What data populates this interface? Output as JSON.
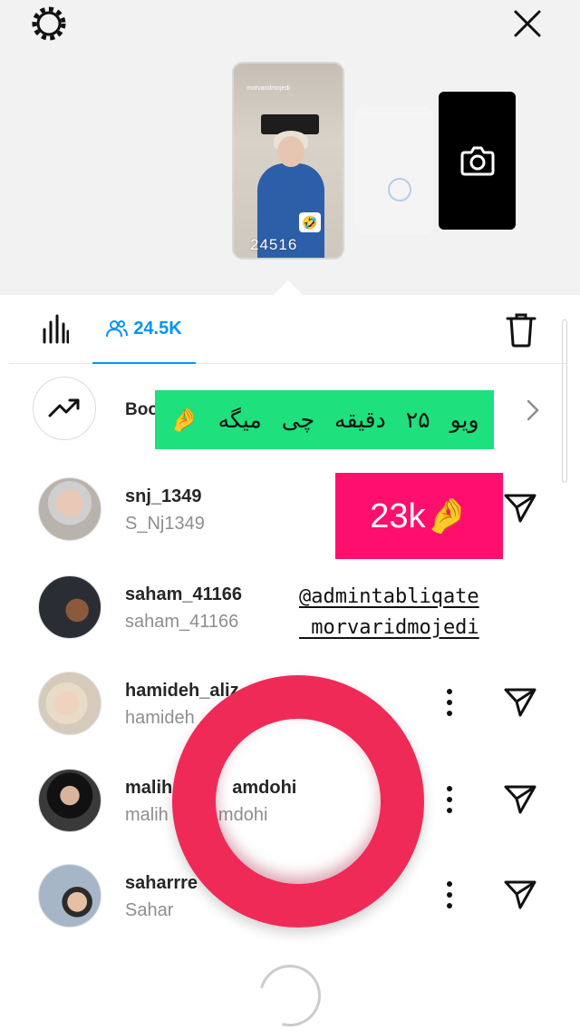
{
  "story": {
    "thumbnail_views": "24516",
    "thumbnail_username": "morvaridmojedi"
  },
  "tabs": {
    "viewers_count": "24.5K"
  },
  "boost": {
    "label": "Boo"
  },
  "viewers": [
    {
      "username": "snj_1349",
      "full_name": "S_Nj1349"
    },
    {
      "username": "saham_41166",
      "full_name": "saham_41166"
    },
    {
      "username": "hamideh_aliz",
      "full_name": "hamideh"
    },
    {
      "username": "malih",
      "username_tail": "amdohi",
      "full_name": "malih",
      "full_name_tail": "amdohi"
    },
    {
      "username": "saharrre",
      "full_name": "Sahar"
    }
  ],
  "stickers": {
    "green_words": [
      "ویو",
      "۲۵",
      "دقیقه",
      "چی",
      "میگه",
      "🤌"
    ],
    "pink_text": "23k🤌",
    "mention_line1": "@admintabliqate",
    "mention_line2": "_morvaridmojedi"
  },
  "colors": {
    "accent": "#0095f6",
    "sticker_green": "#1ee07c",
    "sticker_pink": "#ff0f6d",
    "ring": "#f02a56"
  },
  "icons": [
    "gear-icon",
    "close-icon",
    "camera-icon",
    "insights-icon",
    "viewers-icon",
    "trash-icon",
    "trending-icon",
    "chevron-right-icon",
    "more-icon",
    "send-icon"
  ]
}
